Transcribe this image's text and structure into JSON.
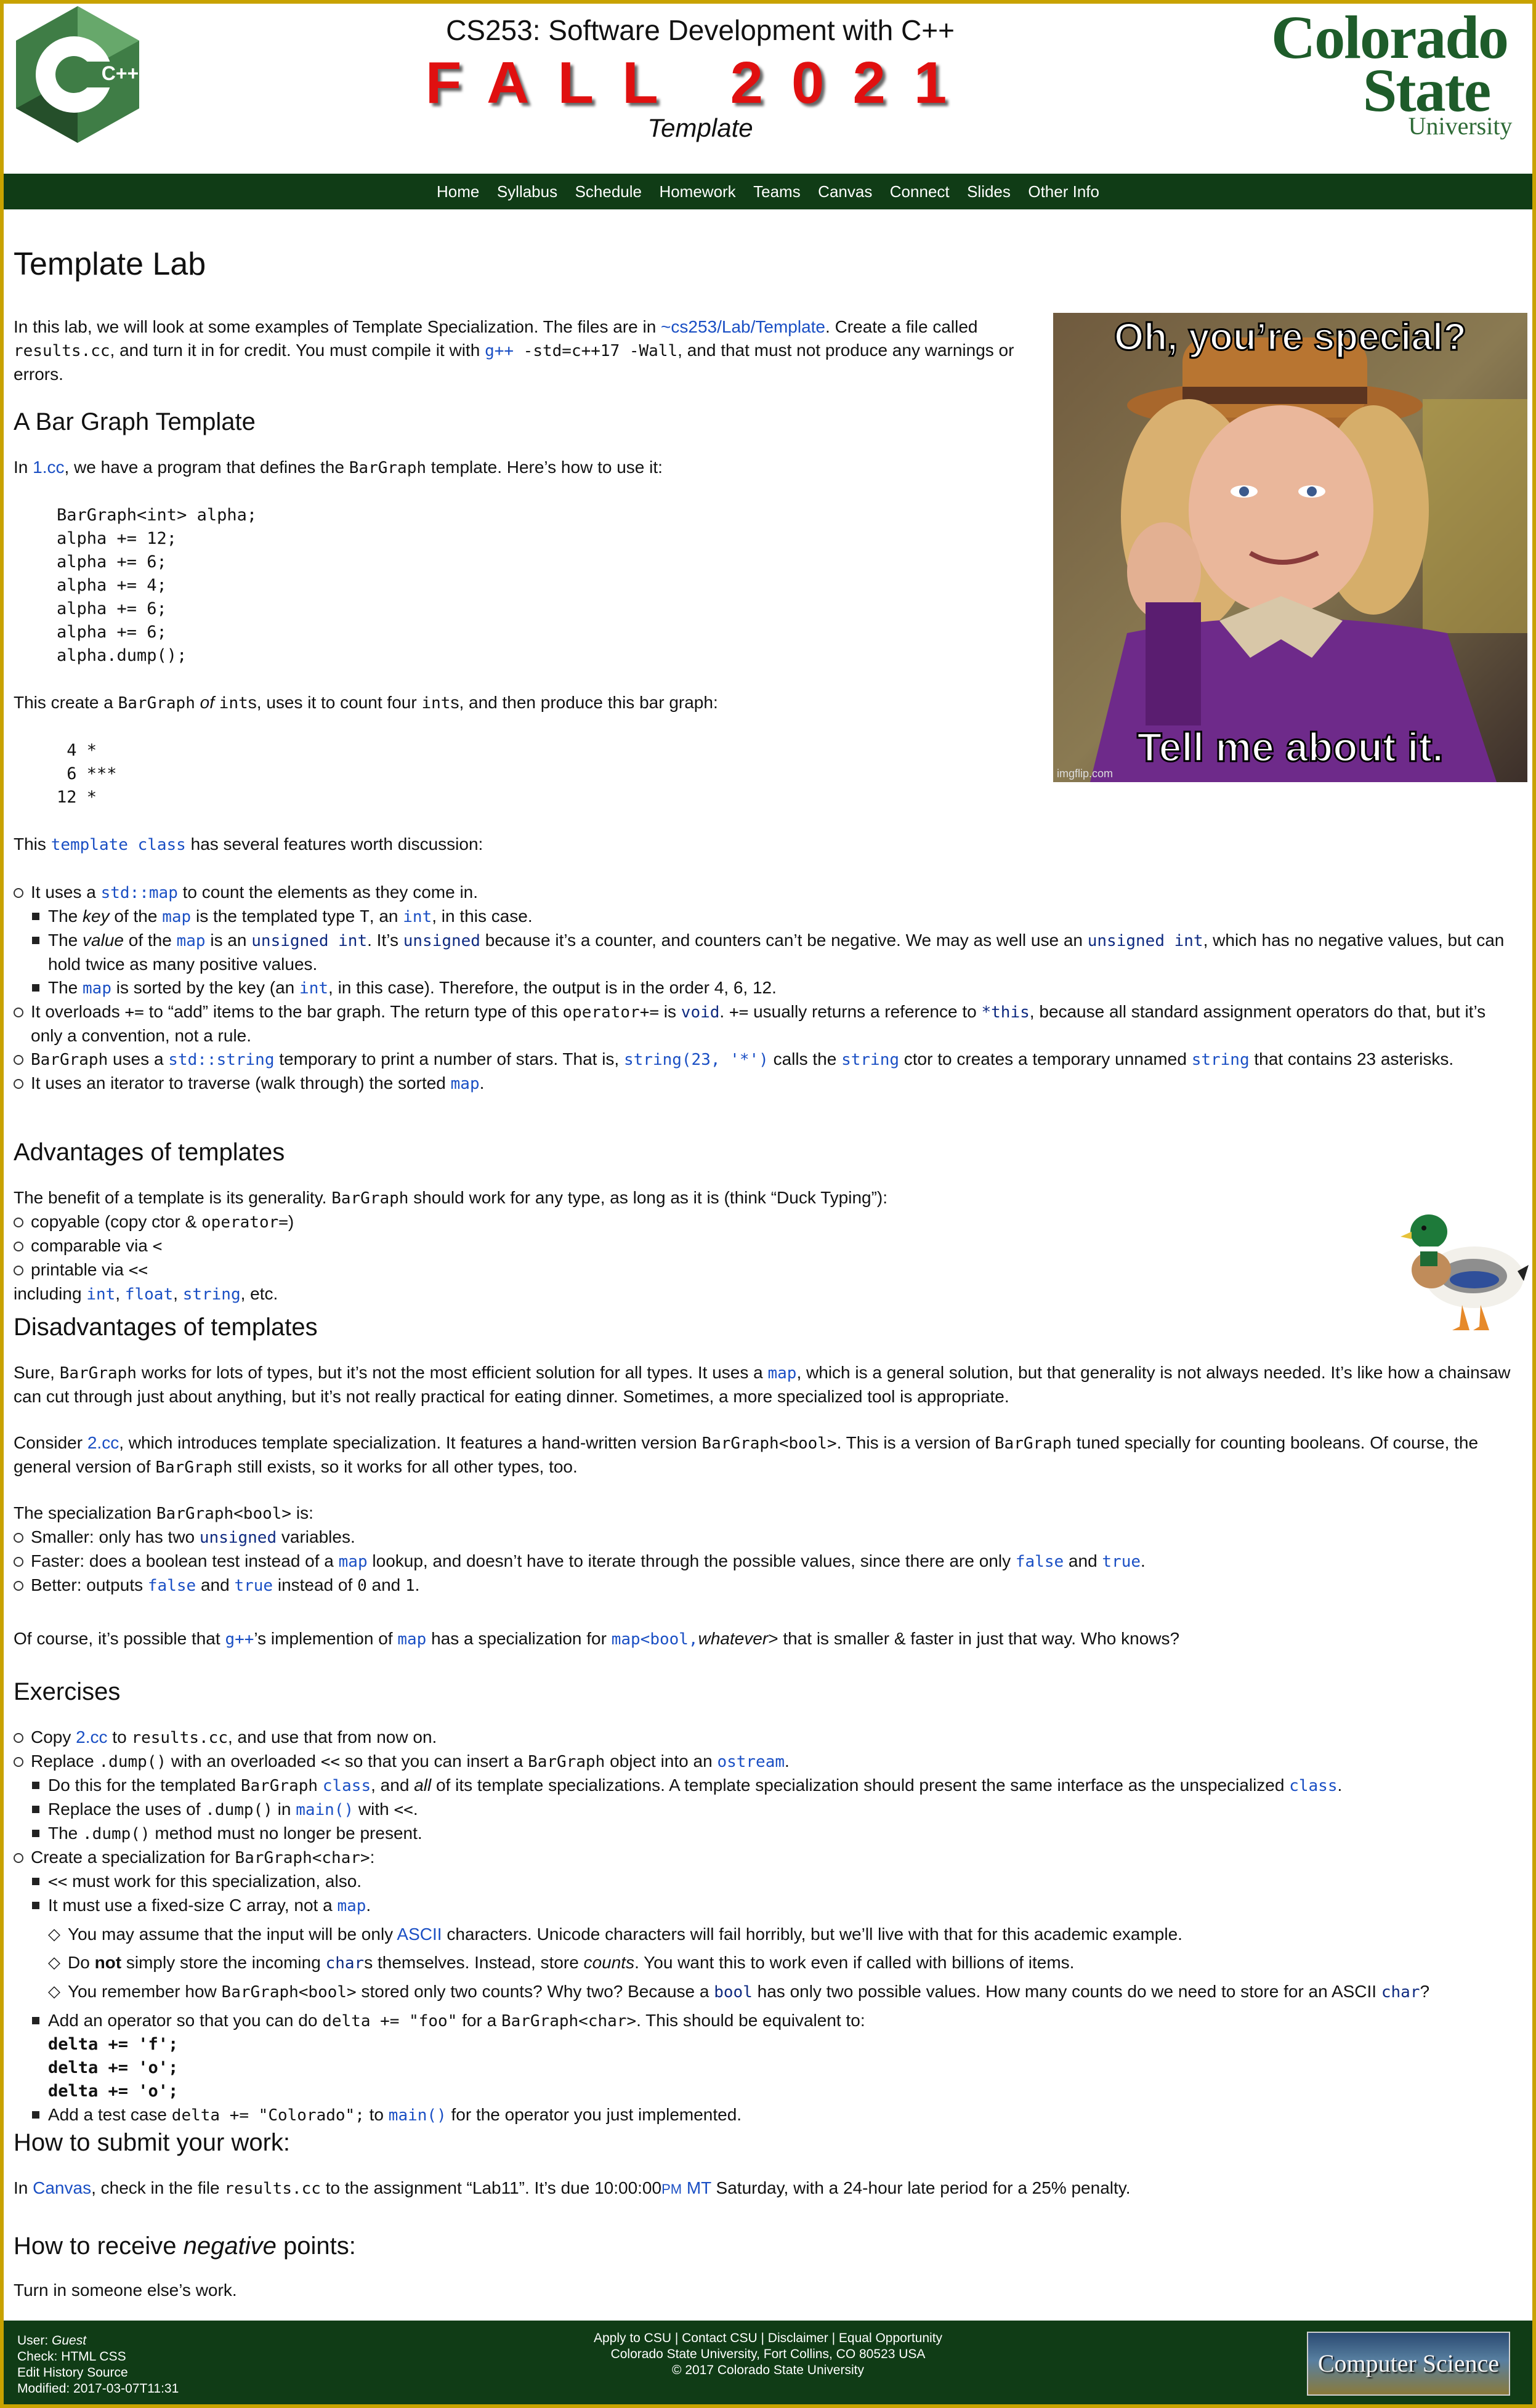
{
  "header": {
    "course_title": "CS253: Software Development with C++",
    "semester": "FALL 2021",
    "subtitle": "Template",
    "logo_text": "C++",
    "csu_logo": {
      "line1": "Colorado",
      "line2": "State",
      "line3": "University"
    }
  },
  "nav": [
    "Home",
    "Syllabus",
    "Schedule",
    "Homework",
    "Teams",
    "Canvas",
    "Connect",
    "Slides",
    "Other Info"
  ],
  "page_title": "Template Lab",
  "meme": {
    "top": "Oh, you’re special?",
    "bottom": "Tell me about it.",
    "credit": "imgflip.com"
  },
  "intro": {
    "t1": "In this lab, we will look at some examples of Template Specialization. The files are in ",
    "link": "~cs253/Lab/Template",
    "t2": ". Create a file called ",
    "file": "results.cc",
    "t3": ", and turn it in for credit. You must compile it with ",
    "cmd": "g++",
    "flags": " -std=c++17 -Wall",
    "t4": ", and that must not produce any warnings or errors."
  },
  "bar_graph": {
    "heading": "A Bar Graph Template",
    "p1a": "In ",
    "p1link": "1.cc",
    "p1b": ", we have a program that defines the ",
    "p1code": "BarGraph",
    "p1c": " template. Here’s how to use it:",
    "code": "BarGraph<int> alpha;\nalpha += 12;\nalpha += 6;\nalpha += 4;\nalpha += 6;\nalpha += 6;\nalpha.dump();",
    "p2a": "This create a ",
    "p2code": "BarGraph",
    "p2em": " of ",
    "p2code2": "int",
    "p2b": "s, uses it to count four ",
    "p2code3": "int",
    "p2c": "s, and then produce this bar graph:",
    "output": " 4 *\n 6 ***\n12 *",
    "p3a": "This ",
    "p3code": "template class",
    "p3b": " has several features worth discussion:"
  },
  "features": {
    "f1a": "It uses a ",
    "f1code": "std::map",
    "f1b": " to count the elements as they come in.",
    "f1s1": [
      "The ",
      "key",
      " of the ",
      "map",
      " is the templated type ",
      "T",
      ", an ",
      "int",
      ", in this case."
    ],
    "f1s2": [
      "The ",
      "value",
      " of the ",
      "map",
      " is an ",
      "unsigned int",
      ". It’s ",
      "unsigned",
      " because it’s a counter, and counters can’t be negative. We may as well use an ",
      "unsigned int",
      ", which has no negative values, but can hold twice as many positive values."
    ],
    "f1s3": [
      "The ",
      "map",
      " is sorted by the key (an ",
      "int",
      ", in this case). Therefore, the output is in the order 4, 6, 12."
    ],
    "f2": [
      "It overloads ",
      "+=",
      " to “add” items to the bar graph. The return type of this ",
      "operator+=",
      " is ",
      "void",
      ". ",
      "+=",
      " usually returns a reference to ",
      "*this",
      ", because all standard assignment operators do that, but it’s only a convention, not a rule."
    ],
    "f3": [
      "BarGraph",
      " uses a ",
      "std::string",
      " temporary to print a number of stars. That is, ",
      "string(23, '*')",
      " calls the ",
      "string",
      " ctor to creates a temporary unnamed ",
      "string",
      " that contains 23 asterisks."
    ],
    "f4": [
      "It uses an iterator to traverse (walk through) the sorted ",
      "map",
      "."
    ]
  },
  "advantages": {
    "heading": "Advantages of templates",
    "p1": [
      "The benefit of a template is its generality. ",
      "BarGraph",
      " should work for any type, as long as it is (think “Duck Typing”):"
    ],
    "items": [
      [
        "copyable (copy ctor & ",
        "operator=",
        ")"
      ],
      [
        "comparable via ",
        "<"
      ],
      [
        "printable via ",
        "<<"
      ]
    ],
    "tail": [
      "including ",
      "int",
      ", ",
      "float",
      ", ",
      "string",
      ", etc."
    ]
  },
  "disadvantages": {
    "heading": "Disadvantages of templates",
    "p1": [
      "Sure, ",
      "BarGraph",
      " works for lots of types, but it’s not the most efficient solution for all types. It uses a ",
      "map",
      ", which is a general solution, but that generality is not always needed. It’s like how a chainsaw can cut through just about anything, but it’s not really practical for eating dinner. Sometimes, a more specialized tool is appropriate."
    ],
    "p2": [
      "Consider ",
      "2.cc",
      ", which introduces template specialization. It features a hand-written version ",
      "BarGraph<bool>",
      ". This is a version of ",
      "BarGraph",
      " tuned specially for counting booleans. Of course, the general version of ",
      "BarGraph",
      " still exists, so it works for all other types, too."
    ],
    "p3": [
      "The specialization ",
      "BarGraph<bool>",
      " is:"
    ],
    "i1": [
      "Smaller: only has two ",
      "unsigned",
      " variables."
    ],
    "i2": [
      "Faster: does a boolean test instead of a ",
      "map",
      " lookup, and doesn’t have to iterate through the possible values, since there are only ",
      "false",
      " and ",
      "true",
      "."
    ],
    "i3": [
      "Better: outputs ",
      "false",
      " and ",
      "true",
      " instead of ",
      "0",
      " and ",
      "1",
      "."
    ],
    "p4": [
      "Of course, it’s possible that ",
      "g++",
      "’s implemention of ",
      "map",
      " has a specialization for ",
      "map<bool,",
      "whatever",
      "> that is smaller & faster in just that way. Who knows?"
    ]
  },
  "exercises": {
    "heading": "Exercises",
    "e1": [
      "Copy ",
      "2.cc",
      " to ",
      "results.cc",
      ", and use that from now on."
    ],
    "e2": [
      "Replace ",
      ".dump()",
      " with an overloaded ",
      "<<",
      " so that you can insert a ",
      "BarGraph",
      " object into an ",
      "ostream",
      "."
    ],
    "e2s1": [
      "Do this for the templated ",
      "BarGraph",
      " ",
      "class",
      ", and ",
      "all",
      " of its template specializations. A template specialization should present the same interface as the unspecialized ",
      "class",
      "."
    ],
    "e2s2": [
      "Replace the uses of ",
      ".dump()",
      " in ",
      "main()",
      " with ",
      "<<",
      "."
    ],
    "e2s3": [
      "The ",
      ".dump()",
      " method must no longer be present."
    ],
    "e3": [
      "Create a specialization for ",
      "BarGraph<char>",
      ":"
    ],
    "e3s1": [
      "<<",
      " must work for this specialization, also."
    ],
    "e3s2": [
      "It must use a fixed-size C array, not a ",
      "map",
      "."
    ],
    "d1": [
      "You may assume that the input will be only ",
      "ASCII",
      " characters. Unicode characters will fail horribly, but we’ll live with that for this academic example."
    ],
    "d2": [
      "Do ",
      "not",
      " simply store the incoming ",
      "char",
      "s themselves. Instead, store ",
      "counts",
      ". You want this to work even if called with billions of items."
    ],
    "d3": [
      "You remember how ",
      "BarGraph<bool>",
      " stored only two counts? Why two? Because a ",
      "bool",
      " has only two possible values. How many counts do we need to store for an ASCII ",
      "char",
      "?"
    ],
    "e3s3": [
      "Add an operator so that you can do ",
      "delta += \"foo\"",
      " for a ",
      "BarGraph<char>",
      ". This should be equivalent to:"
    ],
    "e3code": "delta += 'f';\ndelta += 'o';\ndelta += 'o';",
    "e3s4": [
      "Add a test case ",
      "delta += \"Colorado\";",
      " to ",
      "main()",
      " for the operator you just implemented."
    ]
  },
  "submit": {
    "heading": "How to submit your work:",
    "p": [
      "In ",
      "Canvas",
      ", check in the file ",
      "results.cc",
      " to the assignment “Lab11”. It’s due 10:00:00",
      "PM",
      " MT",
      " Saturday, with a 24-hour late period for a 25% penalty."
    ]
  },
  "negative": {
    "heading_a": "How to receive ",
    "heading_em": "negative",
    "heading_b": " points:",
    "p": "Turn in someone else’s work."
  },
  "footer": {
    "user_label": "User: ",
    "user": "Guest",
    "check": "Check: HTML CSS",
    "edit": "Edit History Source",
    "modified": "Modified: 2017-03-07T11:31",
    "links": "Apply to CSU | Contact CSU | Disclaimer | Equal Opportunity",
    "address": "Colorado State University, Fort Collins, CO 80523 USA",
    "copyright": "© 2017 Colorado State University",
    "badge": "Computer Science"
  }
}
